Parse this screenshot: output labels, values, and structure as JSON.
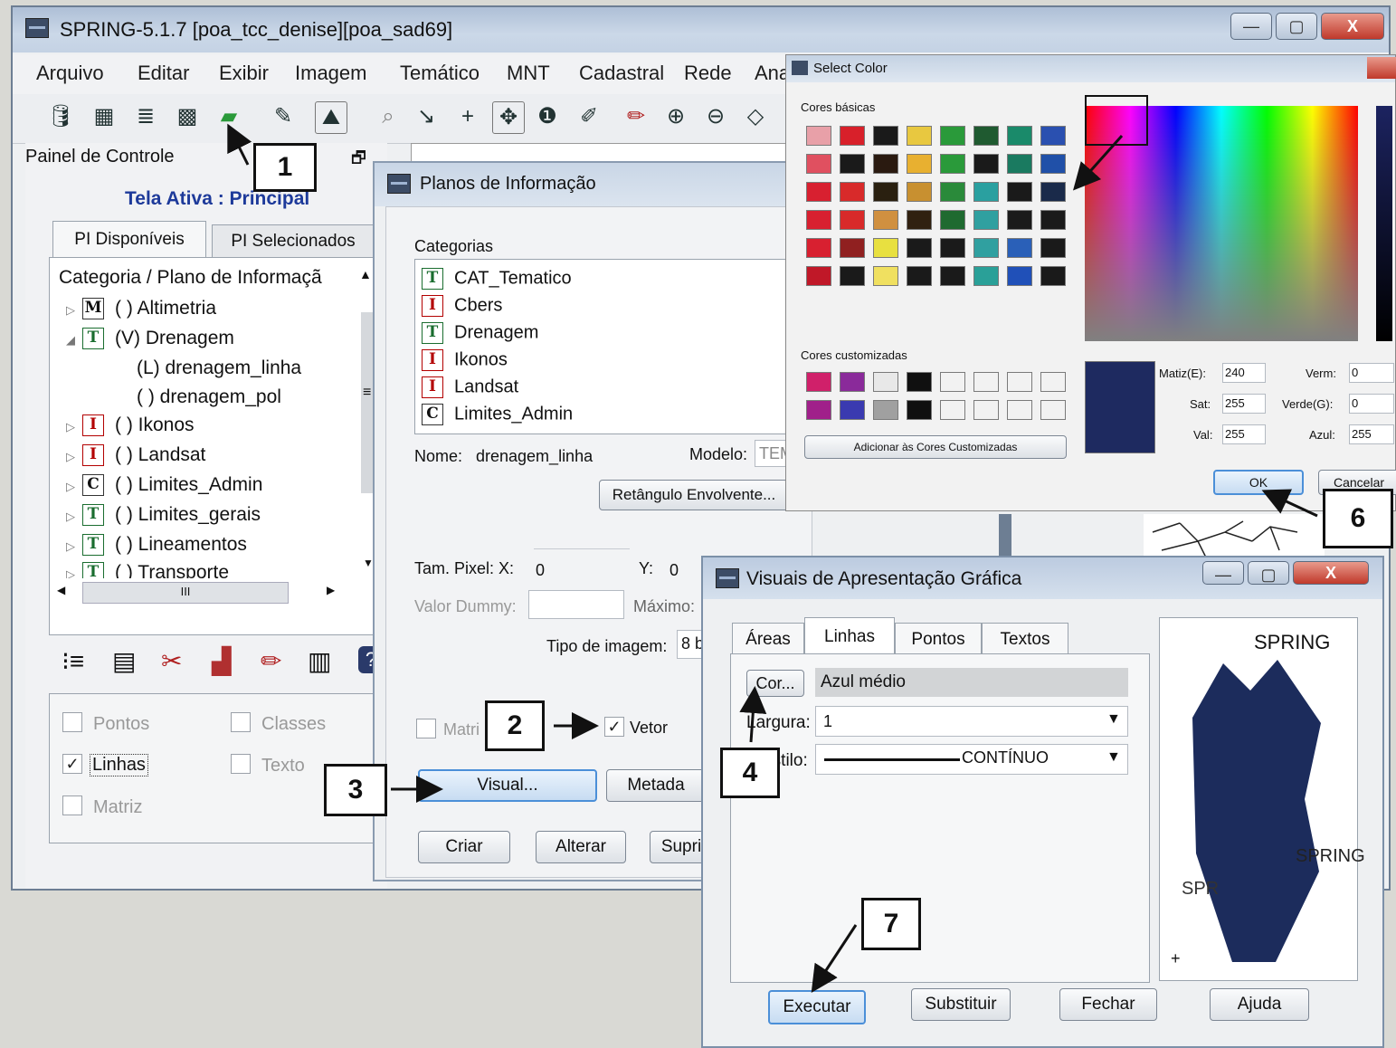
{
  "main_window": {
    "title": "SPRING-5.1.7 [poa_tcc_denise][poa_sad69]",
    "menu": [
      "Arquivo",
      "Editar",
      "Exibir",
      "Imagem",
      "Temático",
      "MNT",
      "Cadastral",
      "Rede",
      "Ana"
    ],
    "caption_buttons": {
      "minimize": "—",
      "maximize": "▢",
      "close": "X"
    }
  },
  "control_panel": {
    "title": "Painel de Controle",
    "active_screen": "Tela Ativa : Principal",
    "tabs": [
      "PI Disponíveis",
      "PI Selecionados"
    ],
    "tree_header": "Categoria / Plano de Informaçã",
    "tree": [
      {
        "icon": "M",
        "text": "( ) Altimetria",
        "expander": "▷"
      },
      {
        "icon": "T",
        "text": "(V) Drenagem",
        "expander": "◢"
      },
      {
        "icon": "",
        "text": "(L) drenagem_linha",
        "expander": ""
      },
      {
        "icon": "",
        "text": "( ) drenagem_pol",
        "expander": ""
      },
      {
        "icon": "I",
        "text": "( ) Ikonos",
        "expander": "▷"
      },
      {
        "icon": "I",
        "text": "( ) Landsat",
        "expander": "▷"
      },
      {
        "icon": "C",
        "text": "( ) Limites_Admin",
        "expander": "▷"
      },
      {
        "icon": "T",
        "text": "( ) Limites_gerais",
        "expander": "▷"
      },
      {
        "icon": "T",
        "text": "( ) Lineamentos",
        "expander": "▷"
      },
      {
        "icon": "T",
        "text": "( ) Transporte",
        "expander": "▷"
      }
    ],
    "scroll_marker": "III",
    "display_options": [
      {
        "label": "Pontos",
        "checked": false
      },
      {
        "label": "Classes",
        "checked": false
      },
      {
        "label": "Linhas",
        "checked": true
      },
      {
        "label": "Texto",
        "checked": false
      },
      {
        "label": "Matriz",
        "checked": false
      }
    ]
  },
  "planos_dialog": {
    "title": "Planos de Informação",
    "categories_label": "Categorias",
    "categories": [
      {
        "icon": "T",
        "name": "CAT_Tematico"
      },
      {
        "icon": "I",
        "name": "Cbers"
      },
      {
        "icon": "T",
        "name": "Drenagem"
      },
      {
        "icon": "I",
        "name": "Ikonos"
      },
      {
        "icon": "I",
        "name": "Landsat"
      },
      {
        "icon": "C",
        "name": "Limites_Admin"
      }
    ],
    "nome_label": "Nome:",
    "nome_value": "drenagem_linha",
    "modelo_label": "Modelo:",
    "modelo_value": "TEM",
    "retangulo_button": "Retângulo Envolvente...",
    "tam_pixel_label": "Tam. Pixel: X:",
    "tam_pixel_x": "0",
    "y_label": "Y:",
    "y_value": "0",
    "valor_dummy_label": "Valor Dummy:",
    "maximo_label": "Máximo:",
    "tipo_imagem_label": "Tipo de imagem:",
    "tipo_imagem_value": "8 b",
    "matriz_label": "Matri",
    "vetor_label": "Vetor",
    "visual_button": "Visual...",
    "metadados_button": "Metada",
    "criar_button": "Criar",
    "alterar_button": "Alterar",
    "suprimir_button": "Supri"
  },
  "select_color": {
    "title": "Select Color",
    "basic_label": "Cores básicas",
    "custom_label": "Cores customizadas",
    "add_button": "Adicionar às Cores Customizadas",
    "basic_colors": [
      "#e8a0a8",
      "#d8202a",
      "#1a1a1a",
      "#e8c840",
      "#2a9a3a",
      "#1f5a30",
      "#1a8a6a",
      "#2a50b0",
      "#e05060",
      "#1a1a1a",
      "#2a1a10",
      "#e8b030",
      "#2a9a3a",
      "#1a1a1a",
      "#1a7a60",
      "#2050a8",
      "#d82030",
      "#d82a2a",
      "#2a2010",
      "#c89030",
      "#2a8a3a",
      "#2aa0a0",
      "#1a1a1a",
      "#1a2a4a",
      "#d82030",
      "#d82a2a",
      "#d09040",
      "#302010",
      "#1f6a30",
      "#30a0a0",
      "#1a1a1a",
      "#1a1a1a",
      "#d82030",
      "#902020",
      "#e8e040",
      "#1a1a1a",
      "#1a1a1a",
      "#30a0a0",
      "#2a60b8",
      "#1a1a1a",
      "#c01828",
      "#1a1a1a",
      "#f0e060",
      "#1a1a1a",
      "#1a1a1a",
      "#2aa098",
      "#2050b8",
      "#1a1a1a"
    ],
    "custom_colors": [
      "#d0206a",
      "#8a2a9a",
      "#e8e8e8",
      "#101010",
      "#f2f2f2",
      "#f2f2f2",
      "#f2f2f2",
      "#f2f2f2",
      "#a0208a",
      "#3a3ab0",
      "#a0a0a0",
      "#101010",
      "#f2f2f2",
      "#f2f2f2",
      "#f2f2f2",
      "#f2f2f2"
    ],
    "selected_preview": "#1e2a60",
    "fields": [
      {
        "label": "Matiz(E):",
        "value": "240"
      },
      {
        "label": "Verm:",
        "value": "0"
      },
      {
        "label": "Sat:",
        "value": "255"
      },
      {
        "label": "Verde(G):",
        "value": "0"
      },
      {
        "label": "Val:",
        "value": "255"
      },
      {
        "label": "Azul:",
        "value": "255"
      }
    ],
    "ok_button": "OK",
    "cancel_button": "Cancelar"
  },
  "visuais_dialog": {
    "title": "Visuais de Apresentação Gráfica",
    "tabs": [
      "Áreas",
      "Linhas",
      "Pontos",
      "Textos"
    ],
    "active_tab": "Linhas",
    "cor_button": "Cor...",
    "cor_value": "Azul médio",
    "largura_label": "Largura:",
    "largura_value": "1",
    "estilo_label": "Estilo:",
    "estilo_value": "CONTÍNUO",
    "preview_title": "SPRING",
    "preview_texts": [
      "SPRING",
      "SPR"
    ],
    "preview_plus": "+",
    "buttons": [
      "Executar",
      "Substituir",
      "Fechar",
      "Ajuda"
    ]
  },
  "callouts": [
    "1",
    "2",
    "3",
    "4",
    "6",
    "7"
  ],
  "colors": {
    "accent_blue": "#4b8fd8",
    "preview_shape": "#1c2c5c"
  }
}
